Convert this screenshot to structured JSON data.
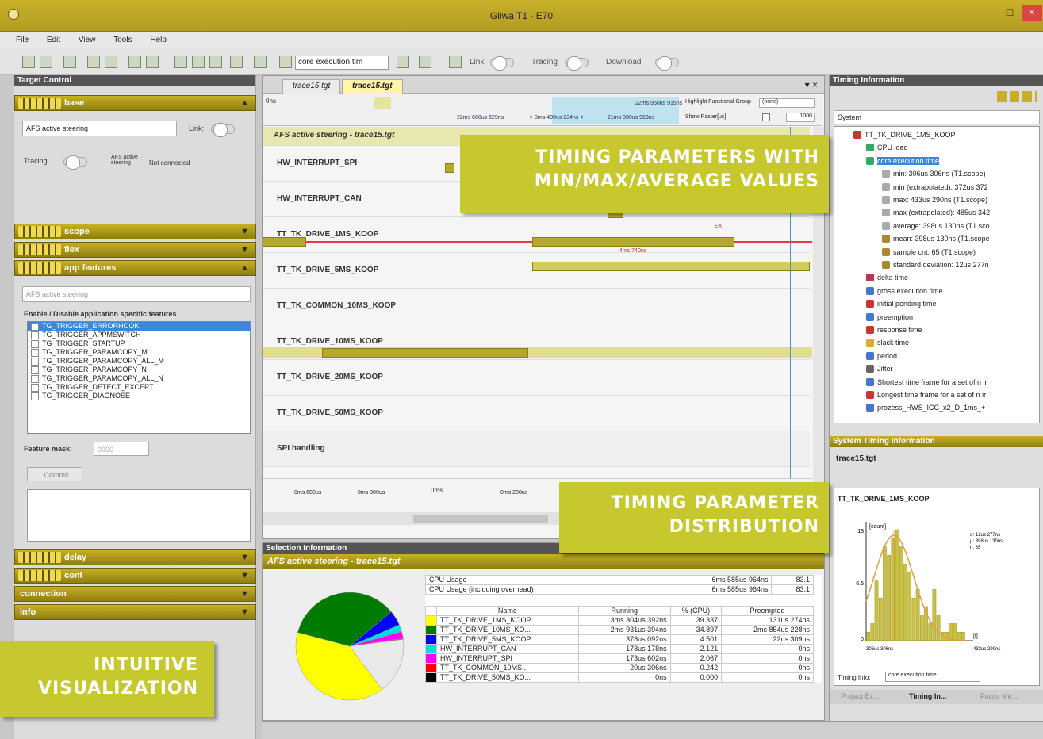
{
  "window": {
    "title": "Gliwa T1 - E70",
    "minimize": "–",
    "maximize": "□",
    "close": "×"
  },
  "menu": [
    "File",
    "Edit",
    "View",
    "Tools",
    "Help"
  ],
  "toolbar": {
    "combo": "core execution tim",
    "link": "Link",
    "tracing": "Tracing",
    "download": "Download"
  },
  "target_control": {
    "title": "Target Control",
    "sections": {
      "base": "base",
      "scope": "scope",
      "flex": "flex",
      "app_features": "app features",
      "delay": "delay",
      "cont": "cont",
      "connection": "connection",
      "info": "info"
    },
    "app_select": "AFS active steering",
    "link_label": "Link:",
    "tracing_label": "Tracing",
    "afs_label": "AFS active steering",
    "not_connected": "Not connected",
    "feature_combo": "AFS active steering",
    "enable_label": "Enable / Disable application specific features",
    "features": [
      "TG_TRIGGER_ERRORHOOK",
      "TG_TRIGGER_APPMSWITCH",
      "TG_TRIGGER_STARTUP",
      "TG_TRIGGER_PARAMCOPY_M",
      "TG_TRIGGER_PARAMCOPY_ALL_M",
      "TG_TRIGGER_PARAMCOPY_N",
      "TG_TRIGGER_PARAMCOPY_ALL_N",
      "TG_TRIGGER_DETECT_EXCEPT",
      "TG_TRIGGER_DIAGNOSE"
    ],
    "feature_mask_label": "Feature mask:",
    "feature_mask_value": "0000",
    "commit": "Commit"
  },
  "trace": {
    "tabs": [
      "trace15.tgt",
      "trace15.tgt"
    ],
    "highlight_label": "Highlight Functional Group",
    "highlight_value": "(none)",
    "show_raster": "Show Raster[us]",
    "raster_value": "1000",
    "ruler_top": "0ns",
    "ruler_marks": [
      "22ms 950us 915ns",
      "22ms 600us 629ns",
      "> 0ms 400us 234ns <",
      "21ms 000us 963ns"
    ],
    "header_track": "AFS active steering - trace15.tgt",
    "tracks": [
      "HW_INTERRUPT_SPI",
      "HW_INTERRUPT_CAN",
      "TT_TK_DRIVE_1MS_KOOP",
      "TT_TK_DRIVE_5MS_KOOP",
      "TT_TK_COMMON_10MS_KOOP",
      "TT_TK_DRIVE_10MS_KOOP",
      "TT_TK_DRIVE_20MS_KOOP",
      "TT_TK_DRIVE_50MS_KOOP",
      "SPI handling"
    ],
    "bottom_ticks": [
      "0ms 600us",
      "0ms 000us",
      "0ms",
      "0ms 200us"
    ],
    "marker": "4ms 740ns",
    "ex": "EX"
  },
  "timing_info": {
    "title": "Timing Information",
    "system": "System",
    "items": [
      "TT_TK_DRIVE_1MS_KOOP",
      "CPU load",
      "core execution time",
      "min: 306us 306ns (T1.scope)",
      "min (extrapolated): 372us 372",
      "max: 433us 290ns (T1.scope)",
      "max (extrapolated): 485us 342",
      "average: 398us 130ns (T1.sco",
      "mean: 398us 130ns (T1.scope",
      "sample cnt: 65 (T1.scope)",
      "standard deviation: 12us 277n",
      "delta time",
      "gross execution time",
      "initial pending time",
      "preemption",
      "response time",
      "slack time",
      "period",
      "Jitter",
      "Shortest time frame for a set of n ir",
      "Longest time frame for a set of n ir",
      "prozess_HWS_ICC_x2_D_1ms_+"
    ]
  },
  "system_timing": {
    "title": "System Timing Information",
    "file": "trace15.tgt",
    "chart_title": "TT_TK_DRIVE_1MS_KOOP",
    "count_label": "[count]",
    "stats": [
      "σ: 12us 277ns",
      "μ: 398us 130ns",
      "n: 65"
    ],
    "x_left": "306us 306ns",
    "x_right": "433us 290ns",
    "unit": "[t]",
    "timing_info_label": "Timing Info:",
    "timing_info_value": "core execution time",
    "y_ticks": [
      "13",
      "6.5",
      "0"
    ],
    "hist_counts": [
      1,
      2,
      7,
      5,
      11,
      10,
      12,
      13,
      11,
      9,
      8,
      5,
      6,
      3,
      4,
      2,
      6,
      3,
      1,
      1,
      2,
      2,
      1,
      1
    ]
  },
  "bottom_tabs": [
    "Project Ex...",
    "Timing In...",
    "Focus Me..."
  ],
  "selection": {
    "title": "Selection Information",
    "sub": "AFS active steering - trace15.tgt",
    "cpu_rows": [
      [
        "CPU Usage",
        "6ms 585us 964ns",
        "83.1"
      ],
      [
        "CPU Usage (including overhead)",
        "6ms 585us 964ns",
        "83.1"
      ]
    ],
    "headers": [
      "Name",
      "Running",
      "% (CPU)",
      "Preempted"
    ],
    "rows": [
      [
        "TT_TK_DRIVE_1MS_KOOP",
        "3ms 304us 392ns",
        "39.337",
        "131us 274ns"
      ],
      [
        "TT_TK_DRIVE_10MS_KO...",
        "2ms 931us 394ns",
        "34.897",
        "2ms 854us 228ns"
      ],
      [
        "TT_TK_DRIVE_5MS_KOOP",
        "378us 092ns",
        "4.501",
        "22us 309ns"
      ],
      [
        "HW_INTERRUPT_CAN",
        "178us 178ns",
        "2.121",
        "0ns"
      ],
      [
        "HW_INTERRUPT_SPI",
        "173us 602ns",
        "2.067",
        "0ns"
      ],
      [
        "TT_TK_COMMON_10MS...",
        "20us 306ns",
        "0.242",
        "0ns"
      ],
      [
        "TT_TK_DRIVE_50MS_KO...",
        "0ns",
        "0.000",
        "0ns"
      ]
    ],
    "colors": [
      "#ffff00",
      "#007a00",
      "#0000ff",
      "#00dddd",
      "#ff00ff",
      "#ff0000",
      "#000000"
    ]
  },
  "chart_data": {
    "type": "pie",
    "values": [
      39.337,
      34.897,
      4.501,
      2.121,
      2.067,
      0.242,
      0.0
    ],
    "labels": [
      "TT_TK_DRIVE_1MS_KOOP",
      "TT_TK_DRIVE_10MS_KO...",
      "TT_TK_DRIVE_5MS_KOOP",
      "HW_INTERRUPT_CAN",
      "HW_INTERRUPT_SPI",
      "TT_TK_COMMON_10MS...",
      "TT_TK_DRIVE_50MS_KO..."
    ]
  },
  "callouts": {
    "timing_params": "TIMING PARAMETERS WITH MIN/MAX/AVERAGE VALUES",
    "distribution": "TIMING PARAMETER DISTRIBUTION",
    "visualization": "INTUITIVE VISUALIZATION"
  }
}
